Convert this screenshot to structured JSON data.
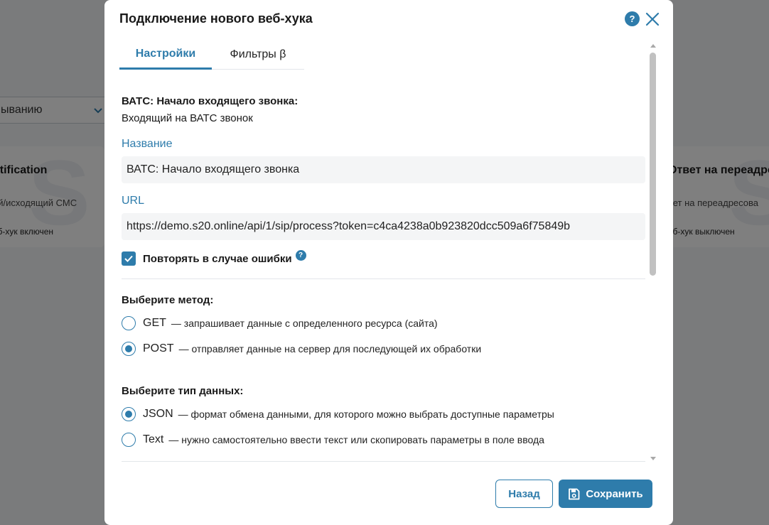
{
  "background": {
    "select_text": "ыванию",
    "cards": [
      {
        "title": "otification",
        "subtitle": "ий/исходящий СМС",
        "status": "еб-хук включен"
      },
      {
        "title": "Ответ на переадре",
        "subtitle": "вет на переадресова",
        "status": "еб-хук выключен"
      }
    ]
  },
  "modal": {
    "title": "Подключение нового веб-хука",
    "help_icon": "?",
    "tabs": [
      {
        "label": "Настройки",
        "active": true
      },
      {
        "label": "Фильтры β",
        "active": false
      }
    ],
    "event_name": "ВАТС: Начало входящего звонка:",
    "event_description": "Входящий на ВАТС звонок",
    "name_label": "Название",
    "name_value": "ВАТС: Начало входящего звонка",
    "url_label": "URL",
    "url_value": "https://demo.s20.online/api/1/sip/process?token=c4ca4238a0b923820dcc509a6f75849b",
    "retry_label": "Повторять в случае ошибки",
    "retry_checked": true,
    "retry_help": "?",
    "method_title": "Выберите метод:",
    "methods": [
      {
        "name": "GET",
        "description": "— запрашивает данные с определенного ресурса (сайта)",
        "selected": false
      },
      {
        "name": "POST",
        "description": "— отправляет данные на сервер для последующей их обработки",
        "selected": true
      }
    ],
    "data_type_title": "Выберите тип данных:",
    "data_types": [
      {
        "name": "JSON",
        "description": "— формат обмена данными, для которого можно выбрать доступные параметры",
        "selected": true
      },
      {
        "name": "Text",
        "description": "— нужно самостоятельно ввести текст или скопировать параметры в поле ввода",
        "selected": false
      }
    ],
    "back_label": "Назад",
    "save_label": "Сохранить"
  },
  "colors": {
    "accent": "#2e7cab",
    "overlay": "rgba(0,0,0,0.5)"
  },
  "icons": {
    "close": "close-icon",
    "checkmark": "checkmark-icon",
    "save": "floppy-disk-icon",
    "chevron": "chevron-down-icon"
  }
}
